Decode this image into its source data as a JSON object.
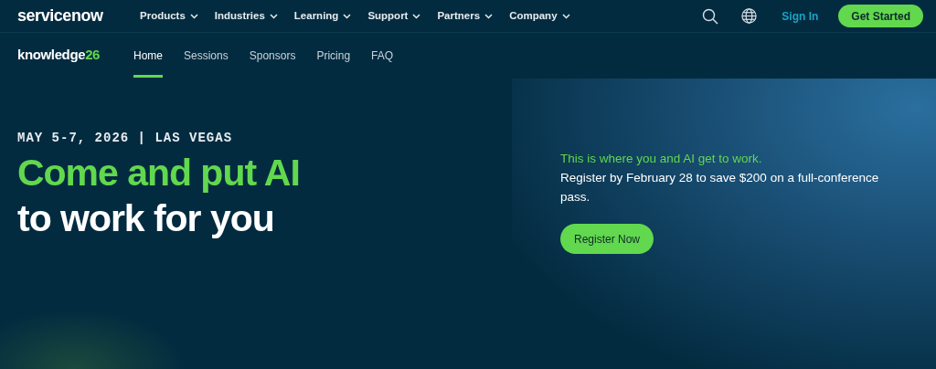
{
  "top_nav": {
    "logo": "servicenow",
    "menu": [
      {
        "label": "Products"
      },
      {
        "label": "Industries"
      },
      {
        "label": "Learning"
      },
      {
        "label": "Support"
      },
      {
        "label": "Partners"
      },
      {
        "label": "Company"
      }
    ],
    "sign_in": "Sign In",
    "cta": "Get Started"
  },
  "sub_nav": {
    "logo": {
      "text": "knowledge",
      "accent": "26"
    },
    "tabs": [
      {
        "label": "Home",
        "selected": true
      },
      {
        "label": "Sessions",
        "selected": false
      },
      {
        "label": "Sponsors",
        "selected": false
      },
      {
        "label": "Pricing",
        "selected": false
      },
      {
        "label": "FAQ",
        "selected": false
      }
    ]
  },
  "hero": {
    "date": "MAY 5-7, 2026 | LAS VEGAS",
    "headline": [
      {
        "text": "Come and put AI",
        "kind": "accent"
      },
      {
        "text": "to work for you",
        "kind": "plain"
      }
    ],
    "tagline": "This is where you and AI get to work.",
    "body": "Register by February 28 to save $200 on a full-conference pass.",
    "button": "Register Now"
  }
}
